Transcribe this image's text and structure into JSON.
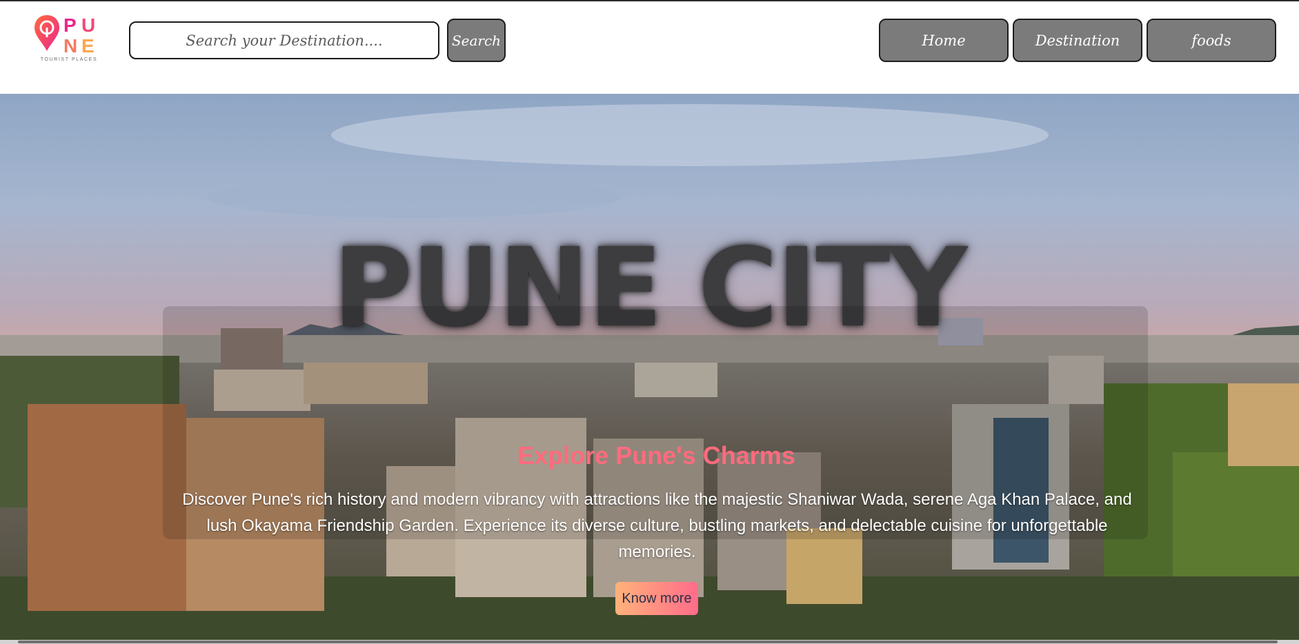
{
  "colors": {
    "brand_pink": "#e9268d",
    "brand_orange": "#ffa64d",
    "nav_button_bg": "#7b7b7b",
    "accent_title": "#ff6b7d",
    "cta_gradient_start": "#ffb27a",
    "cta_gradient_end": "#ff6c8a"
  },
  "header": {
    "logo": {
      "letters": [
        "P",
        "U",
        "N",
        "E"
      ],
      "tagline": "TOURIST PLACES",
      "icon": "map-pin-icon"
    },
    "search": {
      "placeholder": "Search your Destination....",
      "value": "",
      "button_label": "Search"
    },
    "nav": [
      {
        "label": "Home"
      },
      {
        "label": "Destination"
      },
      {
        "label": "foods"
      }
    ]
  },
  "hero": {
    "background": "pune-cityscape-photo",
    "title": "PUNE CITY",
    "heading": "Explore Pune's Charms",
    "description": "Discover Pune's rich history and modern vibrancy with attractions like the majestic Shaniwar Wada, serene Aga Khan Palace, and lush Okayama Friendship Garden. Experience its diverse culture, bustling markets, and delectable cuisine for unforgettable memories.",
    "cta_label": "Know more"
  }
}
